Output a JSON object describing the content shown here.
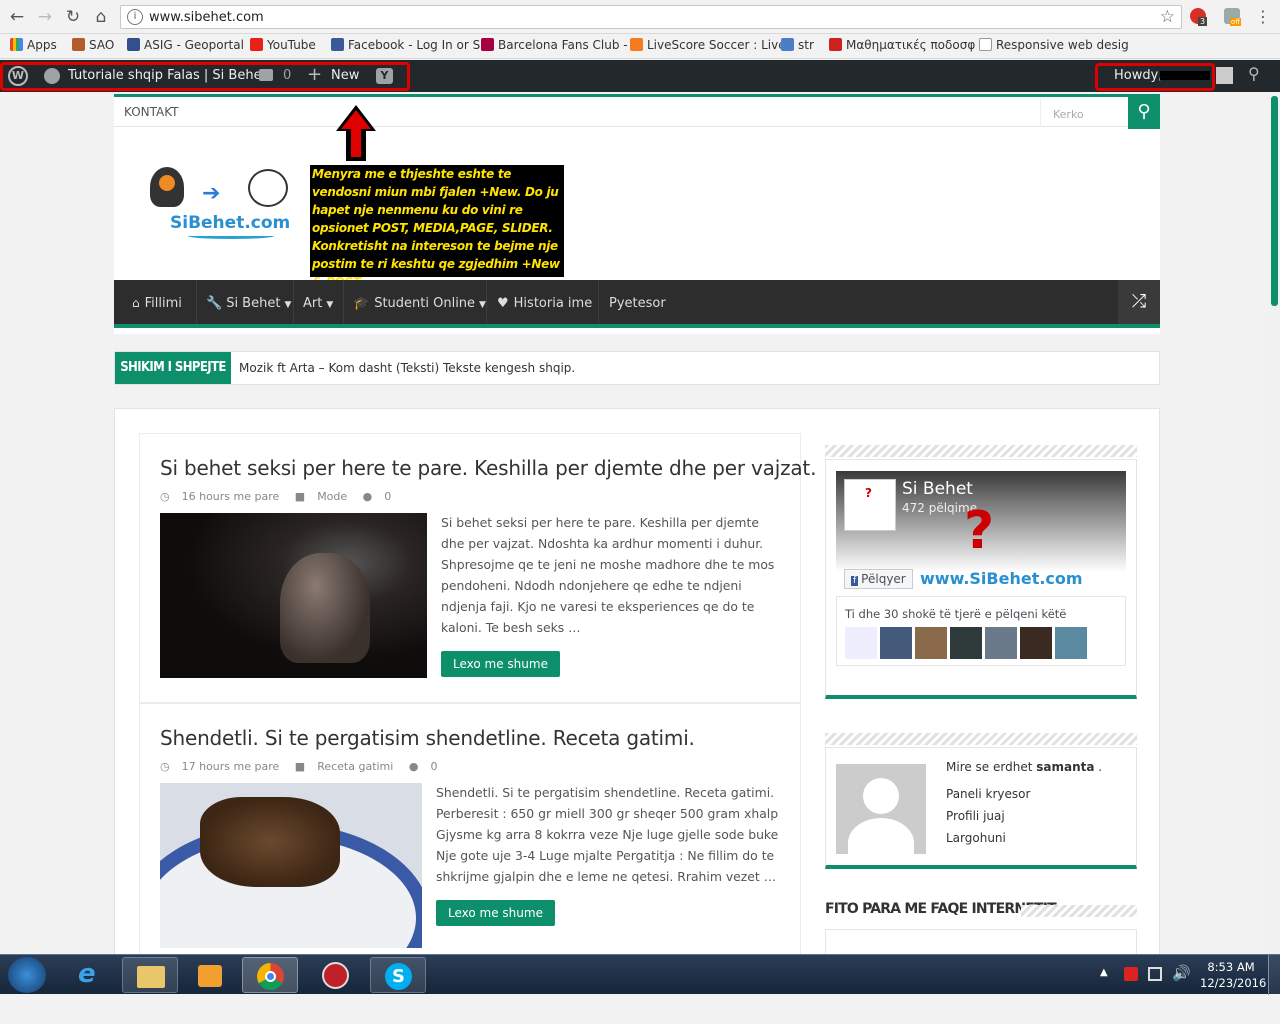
{
  "browser": {
    "url": "www.sibehet.com",
    "extensions": {
      "badge1": "3",
      "badge2": "off"
    },
    "bookmarks": [
      {
        "label": "Apps",
        "color": "#e94235"
      },
      {
        "label": "SAO",
        "color": "#b35b2b"
      },
      {
        "label": "ASIG - Geoportal",
        "color": "#334f8c"
      },
      {
        "label": "YouTube",
        "color": "#e62117"
      },
      {
        "label": "Facebook - Log In or S",
        "color": "#3b5998"
      },
      {
        "label": "Barcelona Fans Club -",
        "color": "#a50044"
      },
      {
        "label": "LiveScore Soccer : Live",
        "color": "#f47b20"
      },
      {
        "label": "str",
        "color": "#4c7dc9"
      },
      {
        "label": "Μαθηματικές ποδοσφ",
        "color": "#cc2222"
      },
      {
        "label": "Responsive web desig",
        "color": "#999999"
      }
    ]
  },
  "adminbar": {
    "site_name": "Tutoriale shqip Falas | Si Behet",
    "comments_count": "0",
    "new_label": "New",
    "howdy": "Howdy,"
  },
  "site": {
    "topnav_link": "KONTAKT",
    "search_placeholder": "Kerko",
    "logo_text": "SiBehet.com",
    "annotation": "Menyra me e thjeshte eshte te vendosni miun mbi fjalen +New. Do ju hapet nje nenmenu ku do vini re opsionet POST, MEDIA,PAGE, SLIDER. Konkretisht na intereson te bejme nje postim te ri keshtu qe zgjedhim +New & POST",
    "menu": [
      "Fillimi",
      "Si Behet",
      "Art",
      "Studenti Online",
      "Historia ime",
      "Pyetesor"
    ],
    "ticker_label": "SHIKIM I SHPEJTE",
    "ticker_text": "Mozik ft Arta – Kom dasht (Teksti) Tekste kengesh shqip.",
    "brand_color": "#0e8f6c"
  },
  "posts": [
    {
      "title": "Si behet seksi per here te pare. Keshilla per djemte dhe per vajzat.",
      "time": "16 hours me pare",
      "category": "Mode",
      "comments": "0",
      "excerpt": "Si behet seksi per here te pare. Keshilla per djemte dhe per vajzat. Ndoshta ka ardhur momenti i duhur. Shpresojme qe te jeni ne moshe madhore dhe te mos pendoheni. Ndodh ndonjehere qe edhe te ndjeni ndjenja faji. Kjo ne varesi te eksperiences qe do te kaloni. Te besh seks …",
      "more": "Lexo me shume"
    },
    {
      "title": "Shendetli. Si te pergatisim shendetline. Receta gatimi.",
      "time": "17 hours me pare",
      "category": "Receta gatimi",
      "comments": "0",
      "excerpt": "Shendetli. Si te pergatisim shendetline. Receta gatimi. Perberesit : 650 gr miell 300 gr sheqer 500 gram xhalp Gjysme kg arra 8 kokrra veze Nje luge gjelle sode buke Nje gote uje 3-4 Luge mjalte Pergatitja : Ne fillim do te shkrijme gjalpin dhe e leme ne qetesi. Rrahim vezet …",
      "more": "Lexo me shume"
    }
  ],
  "facebook": {
    "page_name": "Si Behet",
    "likes": "472 pëlqime",
    "like_button": "Pëlqyer",
    "brand_text": "www.SiBehet.com",
    "friends_text": "Ti dhe 30 shokë të tjerë e pëlqeni këtë"
  },
  "login_widget": {
    "welcome": "Mire se erdhet",
    "username": "samanta",
    "links": [
      "Paneli kryesor",
      "Profili juaj",
      "Largohuni"
    ]
  },
  "widget_title": "FITO PARA ME FAQE INTERNETIT",
  "taskbar": {
    "time": "8:53 AM",
    "date": "12/23/2016"
  }
}
